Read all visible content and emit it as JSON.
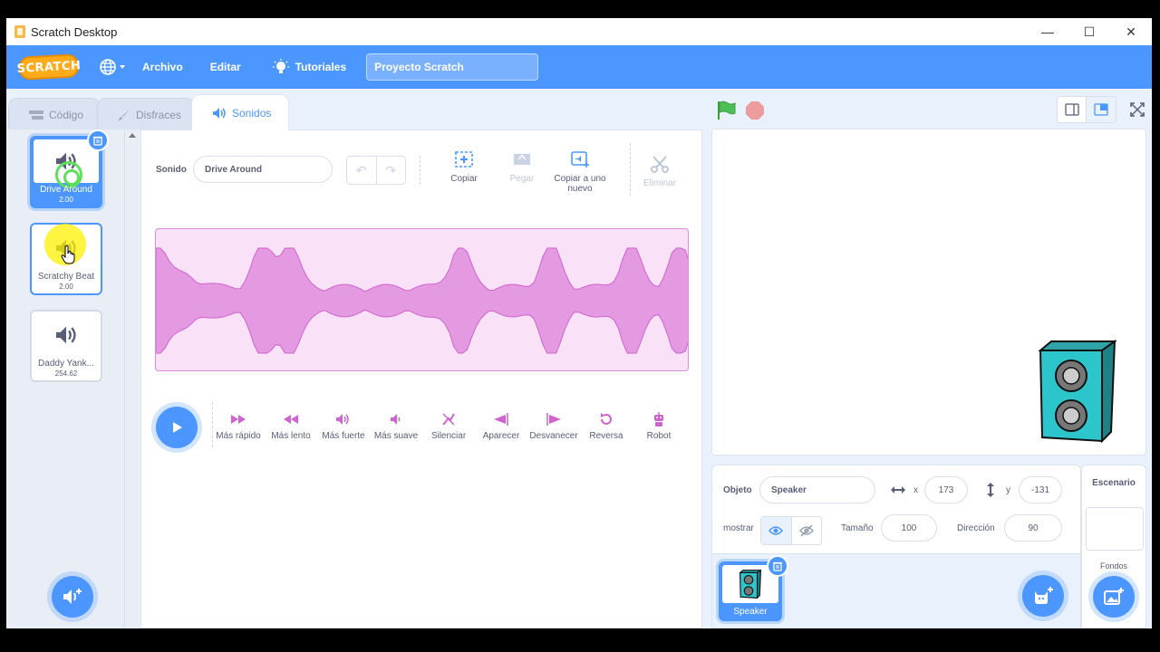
{
  "window": {
    "title": "Scratch Desktop"
  },
  "menubar": {
    "logo": "SCRATCH",
    "file": "Archivo",
    "edit": "Editar",
    "tutorials": "Tutoriales",
    "project_title": "Proyecto Scratch"
  },
  "tabs": {
    "code": "Código",
    "costumes": "Disfraces",
    "sounds": "Sonidos"
  },
  "sounds": [
    {
      "index": "1",
      "name": "Drive Around",
      "duration": "2.00",
      "selected": true
    },
    {
      "index": "2",
      "name": "Scratchy Beat",
      "duration": "2.00",
      "selected": false
    },
    {
      "index": "3",
      "name": "Daddy Yank...",
      "duration": "254.62",
      "selected": false
    }
  ],
  "editor": {
    "sound_label": "Sonido",
    "sound_name": "Drive Around",
    "tools": {
      "copy": "Copiar",
      "paste": "Pegar",
      "copy_new": "Copiar a uno nuevo",
      "delete": "Eliminar"
    },
    "effects": [
      "Más rápido",
      "Más lento",
      "Más fuerte",
      "Más suave",
      "Silenciar",
      "Aparecer",
      "Desvanecer",
      "Reversa",
      "Robot"
    ]
  },
  "sprite_info": {
    "sprite_label": "Objeto",
    "sprite_name": "Speaker",
    "x_label": "x",
    "x_value": "173",
    "y_label": "y",
    "y_value": "-131",
    "show_label": "mostrar",
    "size_label": "Tamaño",
    "size_value": "100",
    "direction_label": "Dirección",
    "direction_value": "90"
  },
  "sprites": [
    {
      "name": "Speaker"
    }
  ],
  "backdrop": {
    "title": "Escenario",
    "label": "Fondos"
  },
  "colors": {
    "accent": "#4c97ff",
    "sound_purple": "#cf63cf",
    "wave_fill": "#e49ae0"
  }
}
